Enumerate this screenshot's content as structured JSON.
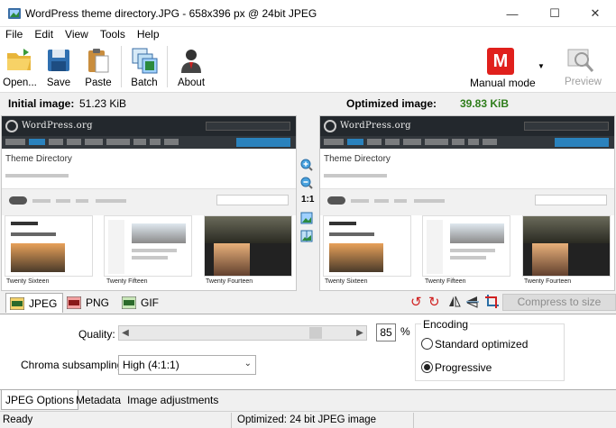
{
  "window": {
    "title": "WordPress theme directory.JPG - 658x396 px @ 24bit JPEG",
    "minimize": "—",
    "maximize": "☐",
    "close": "✕"
  },
  "menu": [
    "File",
    "Edit",
    "View",
    "Tools",
    "Help"
  ],
  "toolbar": {
    "open": "Open...",
    "save": "Save",
    "paste": "Paste",
    "batch": "Batch",
    "about": "About",
    "mode_icon": "M",
    "mode": "Manual mode",
    "preview": "Preview"
  },
  "sizes": {
    "initial_label": "Initial image:",
    "initial_value": "51.23 KiB",
    "optimized_label": "Optimized image:",
    "optimized_value": "39.83 KiB"
  },
  "preview_page": {
    "site": "WordPress.org",
    "heading": "Theme Directory",
    "themes": [
      "Twenty Sixteen",
      "Twenty Fifteen",
      "Twenty Fourteen"
    ]
  },
  "zoom": {
    "one_to_one": "1:1"
  },
  "formats": [
    "JPEG",
    "PNG",
    "GIF"
  ],
  "compress_button": "Compress to size",
  "options": {
    "quality_label": "Quality:",
    "quality_value": "85",
    "quality_unit": "%",
    "quality_level": 0.85,
    "chroma_label": "Chroma subsampling:",
    "chroma_value": "High (4:1:1)",
    "encoding_title": "Encoding",
    "encoding_options": [
      "Standard optimized",
      "Progressive"
    ],
    "encoding_selected": "Progressive"
  },
  "bottom_tabs": [
    "JPEG Options",
    "Metadata",
    "Image adjustments"
  ],
  "status": {
    "left": "Ready",
    "middle": "Optimized: 24 bit JPEG image"
  },
  "colors": {
    "optimized_value": "#2e7d1a",
    "mode_badge": "#e0201c",
    "wp_header": "#23282d",
    "wp_button": "#2a82bd"
  }
}
